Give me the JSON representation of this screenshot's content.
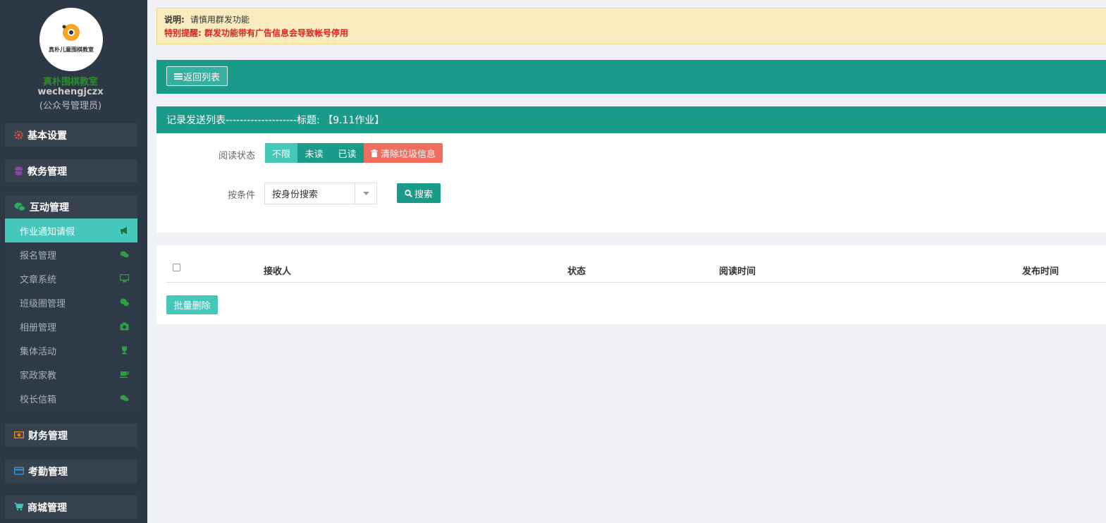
{
  "sidebar": {
    "logo_text": "真朴儿童围棋教室",
    "org_name": "真朴围棋教室",
    "account": "wechengjczx",
    "role": "(公众号管理员)",
    "groups": {
      "basic": {
        "label": "基本设置",
        "icon": "gear-icon",
        "color": "#e84c3d"
      },
      "academic": {
        "label": "教务管理",
        "icon": "database-icon",
        "color": "#8e44ad"
      },
      "interaction": {
        "label": "互动管理",
        "icon": "wechat-icon",
        "color": "#27ae60"
      },
      "finance": {
        "label": "财务管理",
        "icon": "money-icon",
        "color": "#e67e22"
      },
      "attendance": {
        "label": "考勤管理",
        "icon": "card-icon",
        "color": "#3498db"
      },
      "mall": {
        "label": "商城管理",
        "icon": "cart-icon",
        "color": "#45c8b9"
      }
    },
    "items": [
      {
        "label": "作业通知请假",
        "icon": "bullhorn-icon",
        "active": true
      },
      {
        "label": "报名管理",
        "icon": "comments-icon"
      },
      {
        "label": "文章系统",
        "icon": "desktop-icon"
      },
      {
        "label": "班级圈管理",
        "icon": "wechat-icon"
      },
      {
        "label": "相册管理",
        "icon": "camera-icon"
      },
      {
        "label": "集体活动",
        "icon": "trophy-icon"
      },
      {
        "label": "家政家教",
        "icon": "coffee-icon"
      },
      {
        "label": "校长信箱",
        "icon": "comments-icon"
      }
    ],
    "icon_color": "#2ea043"
  },
  "notice": {
    "title": "说明:",
    "text": "请慎用群发功能",
    "warning": "特别提醒: 群发功能带有广告信息会导致帐号停用"
  },
  "toolbar": {
    "back_label": "返回列表"
  },
  "panel": {
    "title": "记录发送列表--------------------标题: 【9.11作业】"
  },
  "filters": {
    "read_status_label": "阅读状态",
    "read_options": [
      "不限",
      "未读",
      "已读"
    ],
    "clear_label": "清除垃圾信息",
    "condition_label": "按条件",
    "condition_value": "按身份搜索",
    "search_label": "搜索"
  },
  "table": {
    "columns": [
      "接收人",
      "状态",
      "阅读时间",
      "发布时间"
    ],
    "batch_delete_label": "批量删除"
  },
  "colors": {
    "teal": "#1a9a88",
    "teal_light": "#45c8b9",
    "danger": "#f06d5f",
    "sidebar_bg": "#2d3846"
  }
}
